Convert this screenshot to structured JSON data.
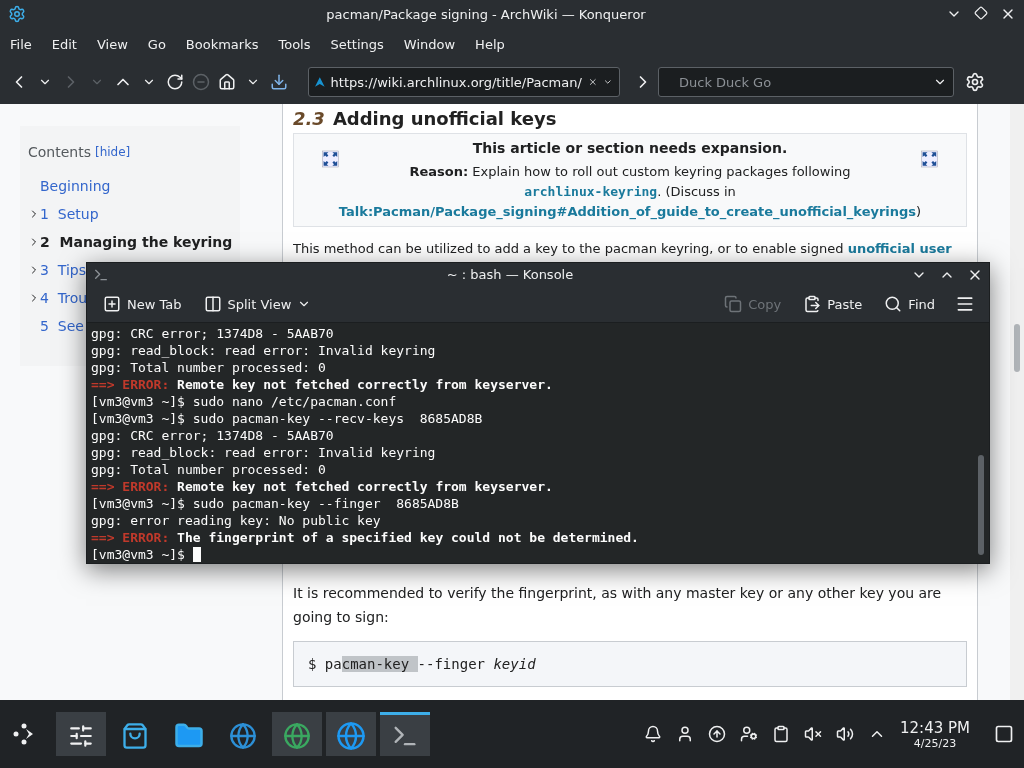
{
  "window": {
    "title": "pacman/Package signing - ArchWiki — Konqueror"
  },
  "menu": [
    "File",
    "Edit",
    "View",
    "Go",
    "Bookmarks",
    "Tools",
    "Settings",
    "Window",
    "Help"
  ],
  "toolbar": {
    "back_disabled": false,
    "forward_disabled": true,
    "stop_disabled": true,
    "url": "https://wiki.archlinux.org/title/Pacman/",
    "search_placeholder": "Duck Duck Go"
  },
  "contents": {
    "title": "Contents",
    "hide": "[hide]",
    "beginning": "Beginning",
    "items": [
      {
        "number": "1",
        "label": "Setup",
        "current": false,
        "expandable": true
      },
      {
        "number": "2",
        "label": "Managing the keyring",
        "current": true,
        "expandable": true
      },
      {
        "number": "3",
        "label": "Tips",
        "current": false,
        "expandable": true
      },
      {
        "number": "4",
        "label": "Trou",
        "current": false,
        "expandable": true
      },
      {
        "number": "5",
        "label": "See",
        "current": false,
        "expandable": false
      }
    ]
  },
  "article": {
    "section_number": "2.3",
    "heading": "Adding unofficial keys",
    "notice": {
      "title": "This article or section needs expansion.",
      "reason": "**Reason:** Explain how to roll out custom keyring packages following",
      "package": "archlinux-keyring",
      "discuss": ". (Discuss in",
      "talk": "Talk:Pacman/Package_signing#Addition_of_guide_to_create_unofficial_keyrings",
      "close": ")"
    },
    "intro": "This method can be utilized to add a key to the pacman keyring, or to enable signed",
    "intro_link": "unofficial user",
    "paragraph": "It is recommended to verify the fingerprint, as with any master key or any other key you are going to sign:",
    "code": [
      {
        "text": "$ pa",
        "kind": "plain"
      },
      {
        "text": "cman-key ",
        "kind": "selected"
      },
      {
        "text": "--finger ",
        "kind": "plain"
      },
      {
        "text": "keyid",
        "kind": "italic"
      }
    ]
  },
  "konsole": {
    "title": "~ : bash — Konsole",
    "toolbar": [
      {
        "label": "New Tab",
        "kind": "newtab",
        "disabled": false
      },
      {
        "label": "Split View",
        "kind": "split",
        "disabled": false
      },
      {
        "label": "Copy",
        "kind": "copy",
        "disabled": true
      },
      {
        "label": "Paste",
        "kind": "paste",
        "disabled": false
      },
      {
        "label": "Find",
        "kind": "find",
        "disabled": false
      }
    ],
    "lines": [
      [
        {
          "text": "gpg: CRC error; 1374D8 - 5AAB70",
          "kind": "plain"
        }
      ],
      [
        {
          "text": "gpg: read_block: read error: Invalid keyring",
          "kind": "plain"
        }
      ],
      [
        {
          "text": "gpg: Total number processed: 0",
          "kind": "plain"
        }
      ],
      [
        {
          "text": "==> ERROR:",
          "kind": "alert"
        },
        {
          "text": " Remote key not fetched correctly from keyserver.",
          "kind": "bold"
        }
      ],
      [
        {
          "text": "[vm3@vm3 ~]$ sudo nano /etc/pacman.conf",
          "kind": "plain"
        }
      ],
      [
        {
          "text": "[vm3@vm3 ~]$ sudo pacman-key --recv-keys  8685AD8B",
          "kind": "plain"
        }
      ],
      [
        {
          "text": "gpg: CRC error; 1374D8 - 5AAB70",
          "kind": "plain"
        }
      ],
      [
        {
          "text": "gpg: read_block: read error: Invalid keyring",
          "kind": "plain"
        }
      ],
      [
        {
          "text": "gpg: Total number processed: 0",
          "kind": "plain"
        }
      ],
      [
        {
          "text": "==> ERROR:",
          "kind": "alert"
        },
        {
          "text": " Remote key not fetched correctly from keyserver.",
          "kind": "bold"
        }
      ],
      [
        {
          "text": "[vm3@vm3 ~]$ sudo pacman-key --finger  8685AD8B",
          "kind": "plain"
        }
      ],
      [
        {
          "text": "gpg: error reading key: No public key",
          "kind": "plain"
        }
      ],
      [
        {
          "text": "==> ERROR:",
          "kind": "alert"
        },
        {
          "text": " The fingerprint of a specified key could not be determined.",
          "kind": "bold"
        }
      ],
      [
        {
          "text": "[vm3@vm3 ~]$ ",
          "kind": "plain"
        }
      ]
    ],
    "cursor": true
  },
  "taskbar": {
    "tasks": [
      {
        "kind": "settings",
        "open": true,
        "selected": false
      },
      {
        "kind": "store",
        "open": false,
        "selected": false
      },
      {
        "kind": "files",
        "open": false,
        "selected": false
      },
      {
        "kind": "browser",
        "open": false,
        "selected": false
      },
      {
        "kind": "browser-new",
        "open": true,
        "selected": false
      },
      {
        "kind": "globe-audio",
        "open": true,
        "selected": false
      },
      {
        "kind": "terminal",
        "open": true,
        "selected": true
      }
    ],
    "time": "12:43 PM",
    "date": "4/25/23"
  }
}
